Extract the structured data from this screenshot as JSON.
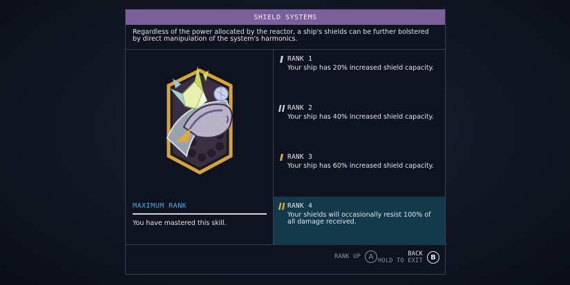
{
  "panel": {
    "title": "SHIELD SYSTEMS",
    "description": "Regardless of the power allocated by the reactor, a ship's shields can be further bolstered by direct manipulation of the system's harmonics."
  },
  "left": {
    "emblem_icon": "shield-ship-emblem-icon",
    "max_rank_label": "MAXIMUM RANK",
    "status_text": "You have mastered this skill."
  },
  "ranks": [
    {
      "title": "RANK 1",
      "desc": "Your ship has 20% increased shield capacity.",
      "icon": "rank-1-icon"
    },
    {
      "title": "RANK 2",
      "desc": "Your ship has 40% increased shield capacity.",
      "icon": "rank-2-icon"
    },
    {
      "title": "RANK 3",
      "desc": "Your ship has 60% increased shield capacity.",
      "icon": "rank-3-icon"
    },
    {
      "title": "RANK 4",
      "desc": "Your shields will occasionally resist 100% of all damage received.",
      "icon": "rank-4-icon"
    }
  ],
  "footer": {
    "rank_up_label": "RANK UP",
    "rank_up_key": "A",
    "back_label": "BACK",
    "hold_label": "HOLD TO EXIT",
    "back_key": "B"
  },
  "colors": {
    "title_bar": "#7a5f9a",
    "accent_blue": "#4aa9df",
    "gold": "#e0a93a",
    "active_row": "#123a4b"
  }
}
